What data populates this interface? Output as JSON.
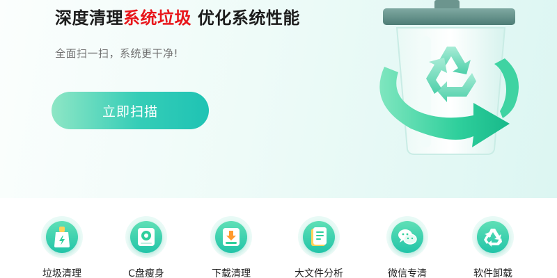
{
  "hero": {
    "headline_part1": "深度清理",
    "headline_highlight": "系统垃圾",
    "headline_part2": " 优化系统性能",
    "subtitle": "全面扫一扫，系统更干净!",
    "scan_button_label": "立即扫描",
    "illustration_icon": "recycle-trash-bin-icon"
  },
  "colors": {
    "accent": "#22c4a8",
    "highlight_red": "#e8161b",
    "button_gradient_start": "#8ee6c5",
    "button_gradient_end": "#1fc3b4"
  },
  "tools": [
    {
      "label": "垃圾清理",
      "icon": "broom-icon"
    },
    {
      "label": "C盘瘦身",
      "icon": "disk-icon"
    },
    {
      "label": "下载清理",
      "icon": "download-icon"
    },
    {
      "label": "大文件分析",
      "icon": "file-analysis-icon"
    },
    {
      "label": "微信专清",
      "icon": "wechat-icon"
    },
    {
      "label": "软件卸载",
      "icon": "uninstall-recycle-icon"
    }
  ]
}
